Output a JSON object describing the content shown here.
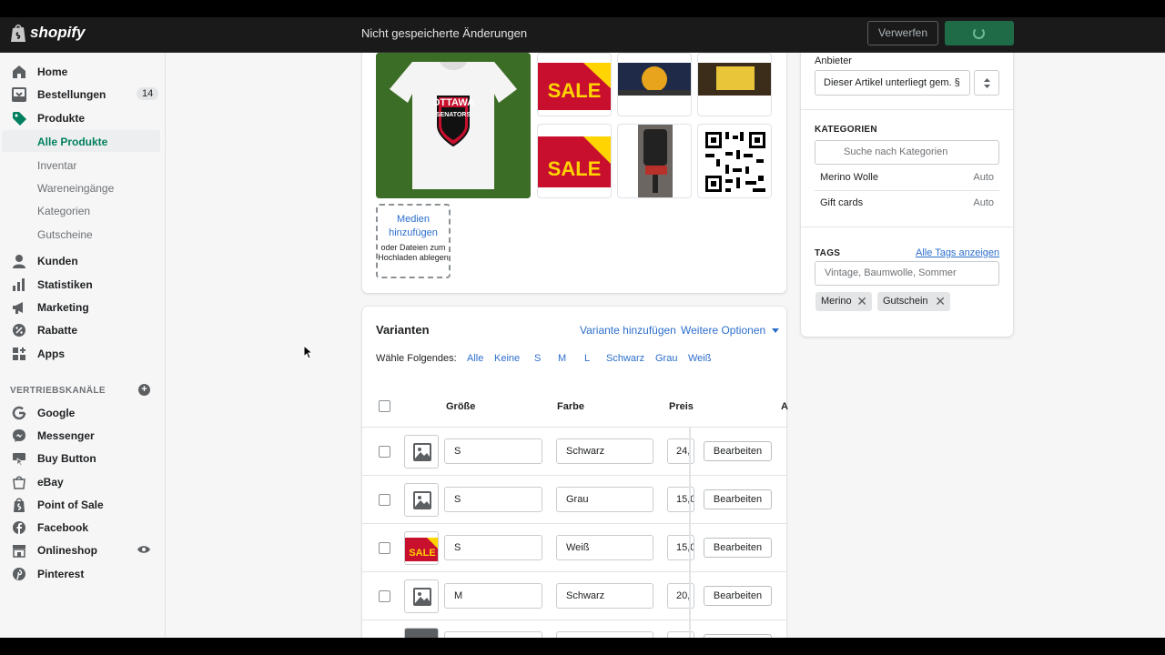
{
  "topbar": {
    "brand": "shopify",
    "unsaved_message": "Nicht gespeicherte Änderungen",
    "discard_label": "Verwerfen"
  },
  "sidebar": {
    "items": [
      {
        "label": "Home",
        "icon": "home-icon"
      },
      {
        "label": "Bestellungen",
        "icon": "orders-icon",
        "badge": "14"
      },
      {
        "label": "Produkte",
        "icon": "tag-icon"
      },
      {
        "label": "Kunden",
        "icon": "person-icon"
      },
      {
        "label": "Statistiken",
        "icon": "chart-icon"
      },
      {
        "label": "Marketing",
        "icon": "megaphone-icon"
      },
      {
        "label": "Rabatte",
        "icon": "discount-icon"
      },
      {
        "label": "Apps",
        "icon": "apps-icon"
      }
    ],
    "product_subitems": [
      "Alle Produkte",
      "Inventar",
      "Wareneingänge",
      "Kategorien",
      "Gutscheine"
    ],
    "channels_heading": "VERTRIEBSKANÄLE",
    "channels": [
      {
        "label": "Google",
        "icon": "google-icon"
      },
      {
        "label": "Messenger",
        "icon": "messenger-icon"
      },
      {
        "label": "Buy Button",
        "icon": "buy-button-icon"
      },
      {
        "label": "eBay",
        "icon": "ebay-icon"
      },
      {
        "label": "Point of Sale",
        "icon": "pos-icon"
      },
      {
        "label": "Facebook",
        "icon": "facebook-icon"
      },
      {
        "label": "Onlineshop",
        "icon": "store-icon"
      },
      {
        "label": "Pinterest",
        "icon": "pinterest-icon"
      }
    ]
  },
  "media": {
    "add_media_link": "Medien hinzufügen",
    "add_media_hint": "oder Dateien zum Hochladen ablegen",
    "shirt_text_1": "OTTAWA",
    "shirt_text_2": "SENATORS",
    "sale_text": "SALE"
  },
  "variants": {
    "title": "Varianten",
    "add_variant": "Variante hinzufügen",
    "more_options": "Weitere Optionen",
    "choose_label": "Wähle Folgendes:",
    "filters": [
      "Alle",
      "Keine",
      "S",
      "M",
      "L",
      "Schwarz",
      "Grau",
      "Weiß"
    ],
    "columns": [
      "Größe",
      "Farbe",
      "Preis",
      "A"
    ],
    "edit_label": "Bearbeiten",
    "rows": [
      {
        "size": "S",
        "color": "Schwarz",
        "price": "24,",
        "image": "placeholder"
      },
      {
        "size": "S",
        "color": "Grau",
        "price": "15,0",
        "image": "placeholder"
      },
      {
        "size": "S",
        "color": "Weiß",
        "price": "15,0",
        "image": "sale"
      },
      {
        "size": "M",
        "color": "Schwarz",
        "price": "20,",
        "image": "placeholder"
      }
    ]
  },
  "organization": {
    "vendor_label": "Anbieter",
    "vendor_value": "Dieser Artikel unterliegt gem. §",
    "categories_heading": "KATEGORIEN",
    "categories_search_placeholder": "Suche nach Kategorien",
    "categories": [
      {
        "name": "Merino Wolle",
        "type": "Auto"
      },
      {
        "name": "Gift cards",
        "type": "Auto"
      }
    ],
    "tags_heading": "TAGS",
    "tags_link": "Alle Tags anzeigen",
    "tags_placeholder": "Vintage, Baumwolle, Sommer",
    "tags": [
      "Merino",
      "Gutschein"
    ]
  },
  "colors": {
    "accent_green": "#008060",
    "link_blue": "#2c6ecb",
    "save_button": "#1f6b47"
  }
}
